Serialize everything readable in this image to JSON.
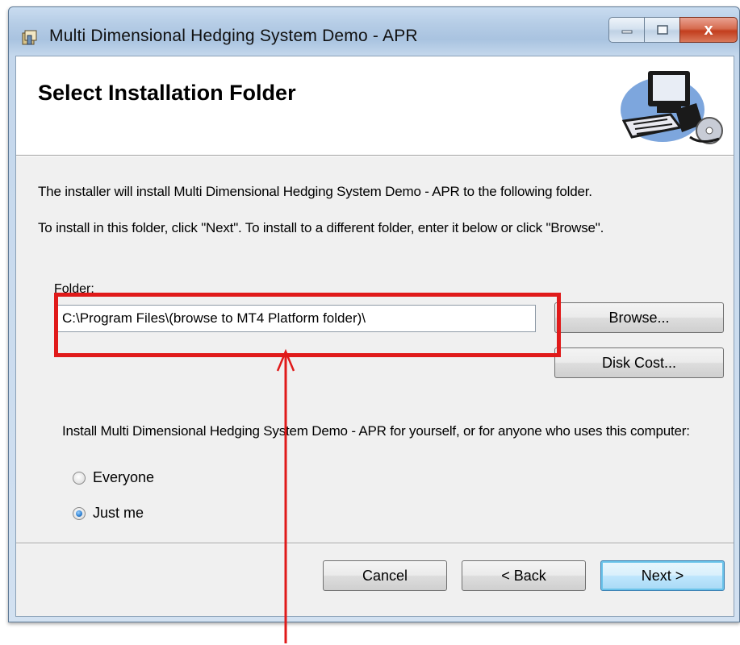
{
  "window": {
    "title": "Multi Dimensional Hedging System Demo - APR",
    "controls": {
      "close_label": "x"
    }
  },
  "header": {
    "title": "Select Installation Folder",
    "art_icon": "computer-install-icon"
  },
  "body": {
    "line1": "The installer will install Multi Dimensional Hedging System Demo - APR to the following folder.",
    "line2": "To install in this folder, click \"Next\". To install to a different folder, enter it below or click \"Browse\".",
    "folder_label": "Folder:",
    "folder_value": "C:\\Program Files\\(browse to MT4 Platform folder)\\",
    "browse_label": "Browse...",
    "disk_cost_label": "Disk Cost...",
    "install_for_text": "Install Multi Dimensional Hedging System Demo - APR for yourself, or for anyone who uses this computer:",
    "options": [
      {
        "label": "Everyone",
        "selected": false
      },
      {
        "label": "Just me",
        "selected": true
      }
    ]
  },
  "footer": {
    "cancel_label": "Cancel",
    "back_label": "< Back",
    "next_label": "Next >"
  },
  "annotation": {
    "highlight_color": "#e01a1a"
  }
}
